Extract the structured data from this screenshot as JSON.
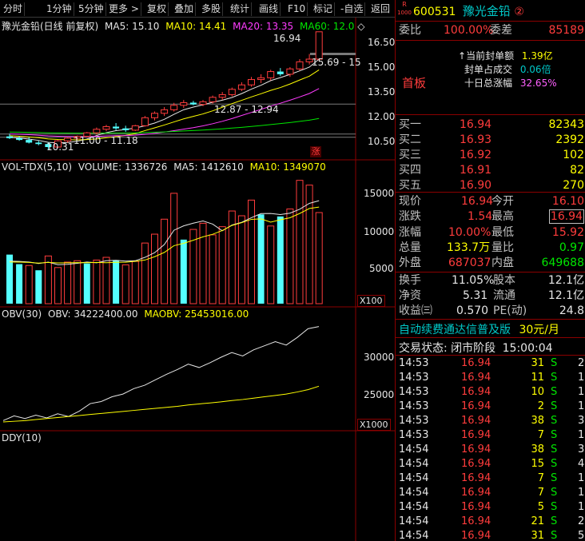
{
  "toolbar": {
    "items": [
      "分时",
      "1分钟",
      "5分钟",
      "更多 >",
      "复权",
      "叠加",
      "多股",
      "统计",
      "画线",
      "F10",
      "标记",
      "-自选",
      "返回"
    ]
  },
  "main_chart": {
    "title": "豫光金铅(日线 前复权)",
    "ma5_label": "MA5: 15.10",
    "ma10_label": "MA10: 14.41",
    "ma20_label": "MA20: 13.35",
    "ma60_label": "MA60: 12.0",
    "ma60_icon": "diamond-outline",
    "y_ticks": [
      "16.50",
      "15.00",
      "13.50",
      "12.00",
      "10.50"
    ],
    "annotations": {
      "high": "16.94",
      "range_top": "15.69 - 15",
      "range_mid": "12.87 - 12.94",
      "range_low": "11.00 - 11.18",
      "low": "10.31"
    },
    "limit_badge": "涨"
  },
  "volume_chart": {
    "title": "VOL-TDX(5,10)",
    "volume_label": "VOLUME: 1336726",
    "ma5_label": "MA5: 1412610",
    "ma10_label": "MA10: 1349070",
    "y_ticks": [
      "15000",
      "10000",
      "5000"
    ],
    "unit": "X100"
  },
  "obv_chart": {
    "title": "OBV(30)",
    "obv_label": "OBV: 34222400.00",
    "maobv_label": "MAOBV: 25453016.00",
    "y_ticks": [
      "30000",
      "25000"
    ],
    "unit": "X1000"
  },
  "ddy_chart": {
    "title": "DDY(10)"
  },
  "stock_header": {
    "badge_top": "R",
    "badge_bottom": "1000",
    "code": "600531",
    "name": "豫光金铅",
    "circle_num": "②"
  },
  "order_ratio": {
    "label_ratio": "委比",
    "ratio": "100.00%",
    "label_diff": "委差",
    "diff": "85189"
  },
  "board": {
    "title": "首板",
    "seal_amount_label": "当前封单额",
    "seal_amount": "1.39亿",
    "seal_deal_label": "封单占成交",
    "seal_deal": "0.06倍",
    "ten_day_label": "十日总涨幅",
    "ten_day": "32.65%"
  },
  "bids": [
    {
      "label": "买一",
      "price": "16.94",
      "vol": "82343"
    },
    {
      "label": "买二",
      "price": "16.93",
      "vol": "2392"
    },
    {
      "label": "买三",
      "price": "16.92",
      "vol": "102"
    },
    {
      "label": "买四",
      "price": "16.91",
      "vol": "82"
    },
    {
      "label": "买五",
      "price": "16.90",
      "vol": "270"
    }
  ],
  "quote": {
    "now_label": "现价",
    "now": "16.94",
    "open_label": "今开",
    "open": "16.10",
    "chg_label": "涨跌",
    "chg": "1.54",
    "high_label": "最高",
    "high": "16.94",
    "pct_label": "涨幅",
    "pct": "10.00%",
    "low_label": "最低",
    "low": "15.92",
    "vol_label": "总量",
    "vol": "133.7万",
    "vr_label": "量比",
    "vr": "0.97",
    "outer_label": "外盘",
    "outer": "687037",
    "inner_label": "内盘",
    "inner": "649688"
  },
  "fundamentals": {
    "turnover_label": "换手",
    "turnover": "11.05%",
    "equity_label": "股本",
    "equity": "12.1亿",
    "nav_label": "净资",
    "nav": "5.31",
    "float_label": "流通",
    "float": "12.1亿",
    "eps_label": "收益㈢",
    "eps": "0.570",
    "pe_label": "PE(动)",
    "pe": "24.8"
  },
  "promo": {
    "text": "自动续费通达信普及版",
    "price": "30元/月"
  },
  "trade_status": {
    "label": "交易状态: 闭市阶段",
    "time": "15:00:04"
  },
  "ticks": [
    {
      "time": "14:53",
      "price": "16.94",
      "vol": "31",
      "side": "S",
      "num": "2"
    },
    {
      "time": "14:53",
      "price": "16.94",
      "vol": "11",
      "side": "S",
      "num": "1"
    },
    {
      "time": "14:53",
      "price": "16.94",
      "vol": "10",
      "side": "S",
      "num": "1"
    },
    {
      "time": "14:53",
      "price": "16.94",
      "vol": "2",
      "side": "S",
      "num": "1"
    },
    {
      "time": "14:53",
      "price": "16.94",
      "vol": "38",
      "side": "S",
      "num": "3"
    },
    {
      "time": "14:53",
      "price": "16.94",
      "vol": "7",
      "side": "S",
      "num": "1"
    },
    {
      "time": "14:54",
      "price": "16.94",
      "vol": "38",
      "side": "S",
      "num": "3"
    },
    {
      "time": "14:54",
      "price": "16.94",
      "vol": "15",
      "side": "S",
      "num": "4"
    },
    {
      "time": "14:54",
      "price": "16.94",
      "vol": "7",
      "side": "S",
      "num": "1"
    },
    {
      "time": "14:54",
      "price": "16.94",
      "vol": "7",
      "side": "S",
      "num": "1"
    },
    {
      "time": "14:54",
      "price": "16.94",
      "vol": "5",
      "side": "S",
      "num": "1"
    },
    {
      "time": "14:54",
      "price": "16.94",
      "vol": "21",
      "side": "S",
      "num": "2"
    },
    {
      "time": "14:54",
      "price": "16.94",
      "vol": "31",
      "side": "S",
      "num": "5"
    }
  ],
  "chart_data": [
    {
      "type": "candlestick",
      "title": "豫光金铅(日线 前复权)",
      "ylim": [
        10.0,
        17.2
      ],
      "candles": [
        {
          "o": 11.05,
          "h": 11.2,
          "l": 10.9,
          "c": 10.95
        },
        {
          "o": 10.95,
          "h": 11.05,
          "l": 10.8,
          "c": 10.85
        },
        {
          "o": 10.85,
          "h": 11.0,
          "l": 10.65,
          "c": 10.7
        },
        {
          "o": 10.7,
          "h": 10.8,
          "l": 10.55,
          "c": 10.62
        },
        {
          "o": 10.62,
          "h": 10.7,
          "l": 10.31,
          "c": 10.45
        },
        {
          "o": 10.45,
          "h": 10.85,
          "l": 10.4,
          "c": 10.8
        },
        {
          "o": 10.8,
          "h": 11.0,
          "l": 10.7,
          "c": 10.95
        },
        {
          "o": 10.95,
          "h": 11.1,
          "l": 10.85,
          "c": 11.05
        },
        {
          "o": 11.05,
          "h": 11.3,
          "l": 11.0,
          "c": 11.25
        },
        {
          "o": 11.25,
          "h": 11.55,
          "l": 11.15,
          "c": 11.45
        },
        {
          "o": 11.45,
          "h": 11.7,
          "l": 11.35,
          "c": 11.6
        },
        {
          "o": 11.6,
          "h": 11.8,
          "l": 11.4,
          "c": 11.5
        },
        {
          "o": 11.5,
          "h": 11.65,
          "l": 11.3,
          "c": 11.4
        },
        {
          "o": 11.4,
          "h": 11.7,
          "l": 11.35,
          "c": 11.65
        },
        {
          "o": 11.65,
          "h": 12.2,
          "l": 11.6,
          "c": 12.1
        },
        {
          "o": 12.1,
          "h": 12.45,
          "l": 11.95,
          "c": 12.35
        },
        {
          "o": 12.35,
          "h": 12.7,
          "l": 12.2,
          "c": 12.55
        },
        {
          "o": 12.55,
          "h": 12.94,
          "l": 12.45,
          "c": 12.8
        },
        {
          "o": 12.8,
          "h": 13.1,
          "l": 12.65,
          "c": 12.95
        },
        {
          "o": 12.95,
          "h": 13.05,
          "l": 12.8,
          "c": 12.85
        },
        {
          "o": 12.85,
          "h": 13.1,
          "l": 12.75,
          "c": 13.0
        },
        {
          "o": 13.0,
          "h": 13.35,
          "l": 12.9,
          "c": 13.25
        },
        {
          "o": 13.25,
          "h": 13.55,
          "l": 13.1,
          "c": 13.4
        },
        {
          "o": 13.4,
          "h": 13.8,
          "l": 13.3,
          "c": 13.7
        },
        {
          "o": 13.7,
          "h": 14.1,
          "l": 13.6,
          "c": 13.95
        },
        {
          "o": 13.95,
          "h": 14.4,
          "l": 13.85,
          "c": 14.25
        },
        {
          "o": 14.25,
          "h": 14.55,
          "l": 14.05,
          "c": 14.35
        },
        {
          "o": 14.35,
          "h": 14.8,
          "l": 14.2,
          "c": 14.7
        },
        {
          "o": 14.7,
          "h": 14.9,
          "l": 14.45,
          "c": 14.55
        },
        {
          "o": 14.55,
          "h": 14.95,
          "l": 14.4,
          "c": 14.85
        },
        {
          "o": 14.85,
          "h": 15.4,
          "l": 14.75,
          "c": 15.25
        },
        {
          "o": 15.25,
          "h": 15.69,
          "l": 15.1,
          "c": 15.4
        },
        {
          "o": 15.4,
          "h": 16.94,
          "l": 15.3,
          "c": 16.94
        }
      ],
      "volume": [
        7200,
        5800,
        5600,
        4900,
        7000,
        5300,
        6100,
        6300,
        5900,
        6400,
        6800,
        6400,
        5700,
        6200,
        8900,
        10200,
        12400,
        16200,
        9400,
        10900,
        11800,
        10100,
        11300,
        13600,
        12900,
        15200,
        13100,
        11400,
        12800,
        13900,
        18100,
        17400,
        13370
      ],
      "volume_rising": [
        false,
        false,
        true,
        false,
        true,
        true,
        true,
        true,
        false,
        true,
        true,
        false,
        true,
        true,
        true,
        true,
        true,
        true,
        false,
        true,
        true,
        true,
        true,
        true,
        true,
        true,
        false,
        true,
        false,
        true,
        true,
        true,
        true
      ],
      "obv_series": [
        20400,
        21100,
        20700,
        21200,
        20800,
        21400,
        21000,
        21800,
        22900,
        23200,
        23900,
        24300,
        25100,
        25600,
        26400,
        27200,
        27900,
        28700,
        28200,
        28900,
        29700,
        30400,
        29900,
        30800,
        31400,
        32000,
        31500,
        32600,
        33900,
        34222
      ],
      "maobv_series": [
        20200,
        20300,
        20400,
        20550,
        20700,
        20850,
        21000,
        21150,
        21300,
        21450,
        21600,
        21750,
        21900,
        22050,
        22200,
        22350,
        22500,
        22700,
        22850,
        23000,
        23150,
        23350,
        23500,
        23700,
        23900,
        24100,
        24300,
        24600,
        24950,
        25453
      ]
    }
  ]
}
